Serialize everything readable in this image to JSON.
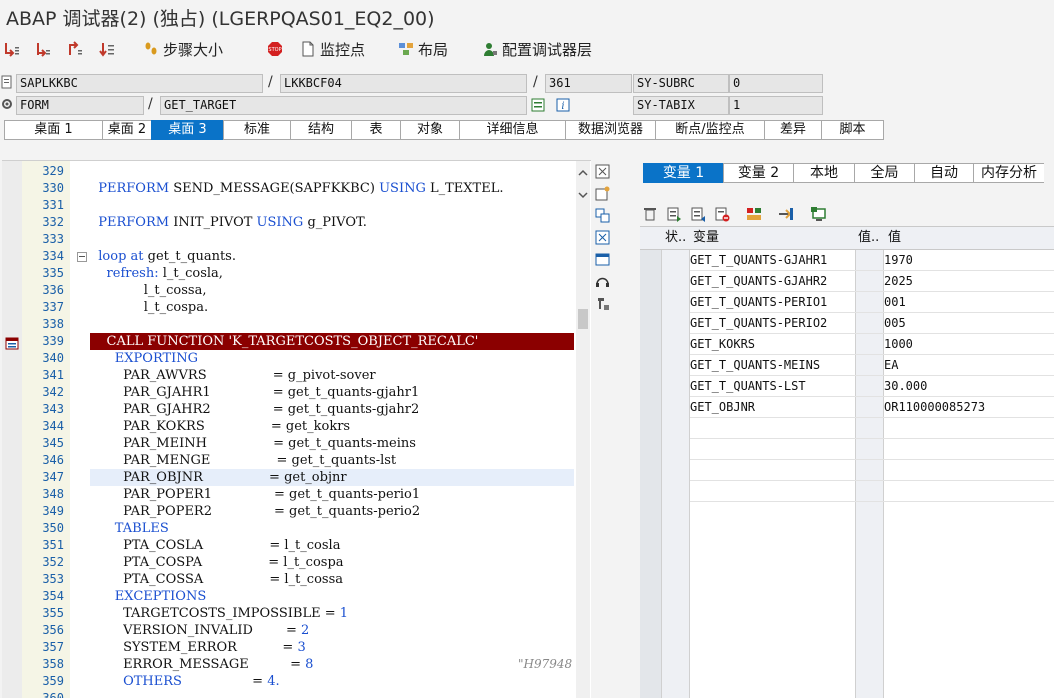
{
  "window": {
    "title": "ABAP 调试器(2) (独占) (LGERPQAS01_EQ2_00)"
  },
  "toolbar": {
    "icons": [
      "step-into-icon",
      "step-over-icon",
      "return-icon",
      "continue-icon"
    ],
    "step_size": "步骤大小",
    "watchpoint": "监控点",
    "layout": "布局",
    "configure_layers": "配置调试器层"
  },
  "info": {
    "program": "SAPLKKBC",
    "include": "LKKBCF04",
    "line": "361",
    "sy_subrc_label": "SY-SUBRC",
    "sy_subrc_value": "0",
    "event_type": "FORM",
    "event_name": "GET_TARGET",
    "sy_tabix_label": "SY-TABIX",
    "sy_tabix_value": "1",
    "separator": "/"
  },
  "tabs": [
    "桌面 1",
    "桌面 2",
    "桌面 3",
    "标准",
    "结构",
    "表",
    "对象",
    "详细信息",
    "数据浏览器",
    "断点/监控点",
    "差异",
    "脚本"
  ],
  "active_tab": "桌面 3",
  "code": {
    "lines": [
      {
        "n": "329",
        "t": ""
      },
      {
        "n": "330",
        "t": "  PERFORM SEND_MESSAGE(SAPFKKBC) USING L_TEXTEL."
      },
      {
        "n": "331",
        "t": ""
      },
      {
        "n": "332",
        "t": "  PERFORM INIT_PIVOT USING g_PIVOT."
      },
      {
        "n": "333",
        "t": ""
      },
      {
        "n": "334",
        "t": "  loop at get_t_quants."
      },
      {
        "n": "335",
        "t": "    refresh: l_t_cosla,"
      },
      {
        "n": "336",
        "t": "             l_t_cossa,"
      },
      {
        "n": "337",
        "t": "             l_t_cospa."
      },
      {
        "n": "338",
        "t": ""
      },
      {
        "n": "339",
        "t": "    CALL FUNCTION 'K_TARGETCOSTS_OBJECT_RECALC'"
      },
      {
        "n": "340",
        "t": "      EXPORTING"
      },
      {
        "n": "341",
        "t": "        PAR_AWVRS                = g_pivot-sover"
      },
      {
        "n": "342",
        "t": "        PAR_GJAHR1               = get_t_quants-gjahr1"
      },
      {
        "n": "343",
        "t": "        PAR_GJAHR2               = get_t_quants-gjahr2"
      },
      {
        "n": "344",
        "t": "        PAR_KOKRS                = get_kokrs"
      },
      {
        "n": "345",
        "t": "        PAR_MEINH                = get_t_quants-meins"
      },
      {
        "n": "346",
        "t": "        PAR_MENGE                = get_t_quants-lst"
      },
      {
        "n": "347",
        "t": "        PAR_OBJNR                = get_objnr"
      },
      {
        "n": "348",
        "t": "        PAR_POPER1               = get_t_quants-perio1"
      },
      {
        "n": "349",
        "t": "        PAR_POPER2               = get_t_quants-perio2"
      },
      {
        "n": "350",
        "t": "      TABLES"
      },
      {
        "n": "351",
        "t": "        PTA_COSLA                = l_t_cosla"
      },
      {
        "n": "352",
        "t": "        PTA_COSPA                = l_t_cospa"
      },
      {
        "n": "353",
        "t": "        PTA_COSSA                = l_t_cossa"
      },
      {
        "n": "354",
        "t": "      EXCEPTIONS"
      },
      {
        "n": "355",
        "t": "        TARGETCOSTS_IMPOSSIBLE = 1"
      },
      {
        "n": "356",
        "t": "        VERSION_INVALID        = 2"
      },
      {
        "n": "357",
        "t": "        SYSTEM_ERROR           = 3"
      },
      {
        "n": "358",
        "t": "        ERROR_MESSAGE          = 8"
      },
      {
        "n": "359",
        "t": "        OTHERS                 = 4."
      },
      {
        "n": "360",
        "t": ""
      }
    ],
    "comment_tag": "\"H97948",
    "breakpoint_line": "339",
    "cursor_line": "347"
  },
  "right": {
    "tabs": [
      "变量 1",
      "变量 2",
      "本地",
      "全局",
      "自动",
      "内存分析"
    ],
    "active_tab": "变量 1",
    "headers": {
      "status": "状..",
      "variable": "变量",
      "value_short": "值..",
      "value": "值"
    },
    "rows": [
      {
        "var": "GET_T_QUANTS-GJAHR1",
        "val": "1970"
      },
      {
        "var": "GET_T_QUANTS-GJAHR2",
        "val": "2025"
      },
      {
        "var": "GET_T_QUANTS-PERIO1",
        "val": "001"
      },
      {
        "var": "GET_T_QUANTS-PERIO2",
        "val": "005"
      },
      {
        "var": "GET_KOKRS",
        "val": "1000"
      },
      {
        "var": "GET_T_QUANTS-MEINS",
        "val": "EA"
      },
      {
        "var": "GET_T_QUANTS-LST",
        "val": "30.000"
      },
      {
        "var": "GET_OBJNR",
        "val": "OR110000085273"
      }
    ]
  }
}
